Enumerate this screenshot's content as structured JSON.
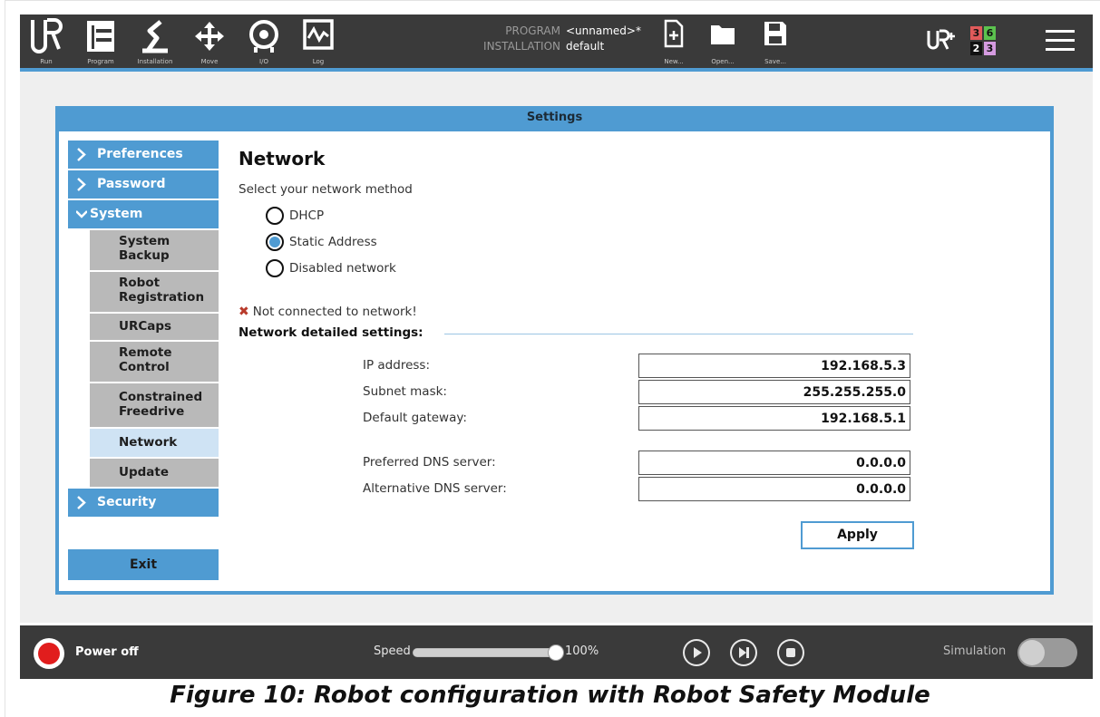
{
  "topbar": {
    "nav": [
      {
        "label": "Run",
        "icon": "ur-logo-icon"
      },
      {
        "label": "Program",
        "icon": "program-icon"
      },
      {
        "label": "Installation",
        "icon": "installation-icon"
      },
      {
        "label": "Move",
        "icon": "move-icon"
      },
      {
        "label": "I/O",
        "icon": "io-icon"
      },
      {
        "label": "Log",
        "icon": "log-icon"
      }
    ],
    "program_key": "PROGRAM",
    "program_value": "<unnamed>*",
    "installation_key": "INSTALLATION",
    "installation_value": "default",
    "file": [
      {
        "label": "New...",
        "icon": "new-file-icon"
      },
      {
        "label": "Open...",
        "icon": "open-folder-icon"
      },
      {
        "label": "Save...",
        "icon": "save-icon"
      }
    ],
    "urplus_icon": "urcaps-plus-icon",
    "badges": {
      "tl": "3",
      "tr": "6",
      "bl": "2",
      "br": "3"
    },
    "badge_colors": {
      "tl": "#e05a5a",
      "tr": "#5bc24e",
      "bl": "#111111",
      "br": "#d59be0"
    },
    "menu_icon": "hamburger-menu-icon"
  },
  "settings": {
    "title": "Settings",
    "sidebar": {
      "preferences": "Preferences",
      "password": "Password",
      "system": "System",
      "sub": [
        {
          "label": "System Backup"
        },
        {
          "label": "Robot Registration"
        },
        {
          "label": "URCaps"
        },
        {
          "label": "Remote Control"
        },
        {
          "label": "Constrained Freedrive"
        },
        {
          "label": "Network",
          "active": true
        },
        {
          "label": "Update"
        }
      ],
      "security": "Security",
      "exit": "Exit"
    },
    "network": {
      "heading": "Network",
      "prompt": "Select your network method",
      "methods": [
        {
          "label": "DHCP",
          "selected": false
        },
        {
          "label": "Static Address",
          "selected": true
        },
        {
          "label": "Disabled network",
          "selected": false
        }
      ],
      "status": "Not connected to network!",
      "section": "Network detailed settings:",
      "fields": [
        {
          "label": "IP address:",
          "value": "192.168.5.3"
        },
        {
          "label": "Subnet mask:",
          "value": "255.255.255.0"
        },
        {
          "label": "Default gateway:",
          "value": "192.168.5.1"
        },
        {
          "label": "Preferred DNS server:",
          "value": "0.0.0.0"
        },
        {
          "label": "Alternative DNS server:",
          "value": "0.0.0.0"
        }
      ],
      "apply": "Apply"
    }
  },
  "bottombar": {
    "power": "Power off",
    "speed_label": "Speed",
    "speed_value": "100%",
    "speed_fraction": 1.0,
    "controls": [
      "play-icon",
      "step-icon",
      "stop-icon"
    ],
    "simulation": "Simulation",
    "simulation_on": false
  },
  "caption": "Figure 10: Robot configuration with Robot Safety Module",
  "colors": {
    "accent": "#4f9bd2",
    "bar": "#3a3a3a",
    "power": "#e11d1d"
  }
}
